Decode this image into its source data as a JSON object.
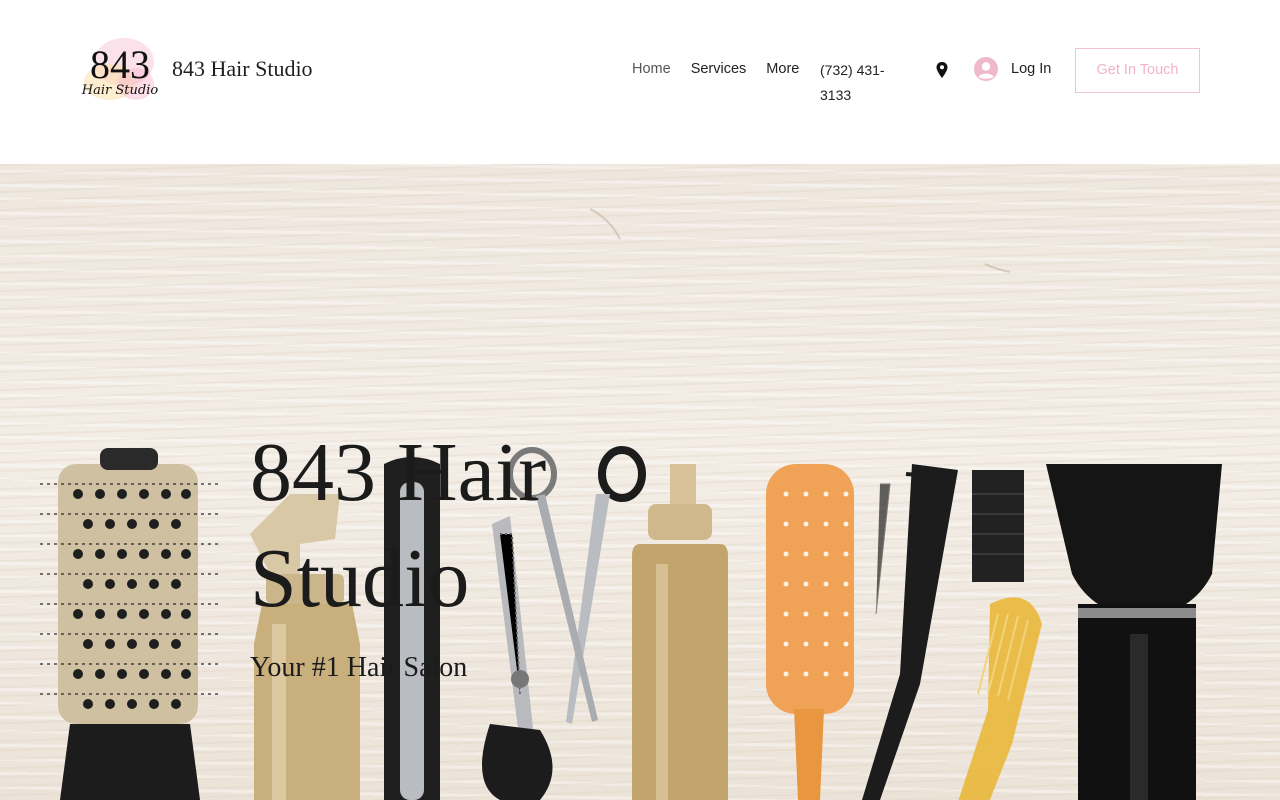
{
  "header": {
    "logo": {
      "number": "843",
      "script": "Hair Studio"
    },
    "site_title": "843 Hair Studio",
    "nav": [
      {
        "label": "Home"
      },
      {
        "label": "Services"
      },
      {
        "label": "More"
      }
    ],
    "phone": "(732) 431-3133",
    "login_label": "Log In",
    "cta_label": "Get In Touch"
  },
  "hero": {
    "title": "843 Hair Studio",
    "subtitle": "Your #1 Hair Salon"
  },
  "icons": {
    "pin": "map-pin-icon",
    "avatar": "user-avatar-icon"
  },
  "colors": {
    "cta_text": "#f2b3c8",
    "cta_border": "#f2c3d3",
    "avatar": "#f0b8cc"
  }
}
